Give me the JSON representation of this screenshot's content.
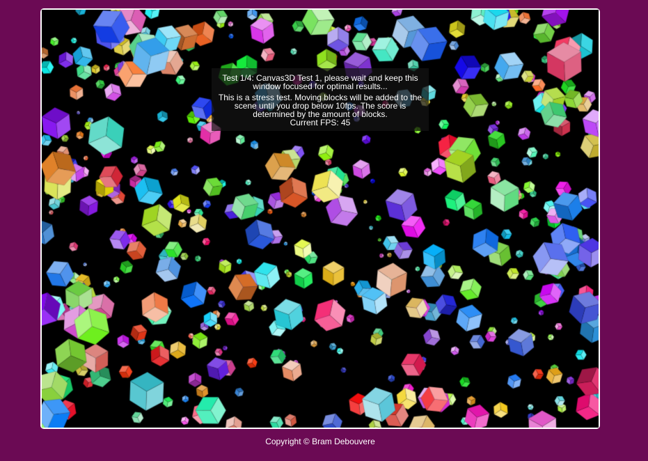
{
  "test": {
    "title": "Test 1/4: Canvas3D Test 1, please wait and keep this window focused for optimal results...",
    "description": "This is a stress test. Moving blocks will be added to the scene until you drop below 10fps. The score is determined by the amount of blocks.",
    "fps_label": "Current FPS: 45"
  },
  "footer": {
    "copyright": "Copyright © Bram Debouvere"
  },
  "colors": {
    "background": "#6b0a54",
    "stage": "#000000",
    "frame": "#ffffff"
  }
}
